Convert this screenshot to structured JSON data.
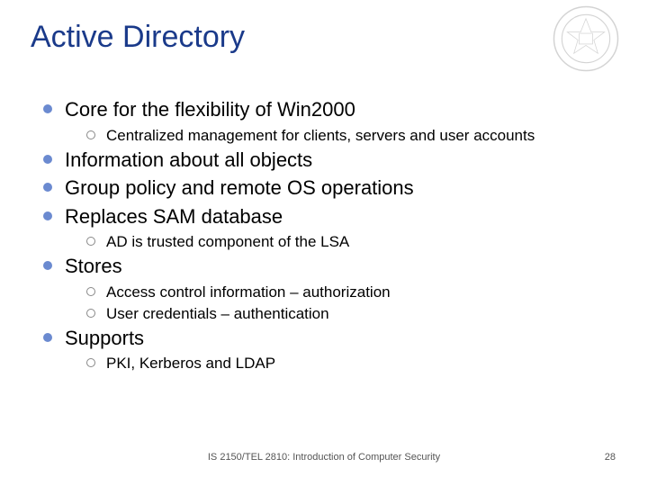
{
  "title": "Active Directory",
  "bullets": {
    "b0": {
      "text": "Core for the flexibility of Win2000"
    },
    "b0_sub0": {
      "text": "Centralized management for clients, servers and user accounts"
    },
    "b1": {
      "text": "Information about all objects"
    },
    "b2": {
      "text": "Group policy and remote OS operations"
    },
    "b3": {
      "text": "Replaces SAM database"
    },
    "b3_sub0": {
      "text": "AD is trusted component of the LSA"
    },
    "b4": {
      "text": "Stores"
    },
    "b4_sub0": {
      "text": "Access control information – authorization"
    },
    "b4_sub1": {
      "text": "User credentials – authentication"
    },
    "b5": {
      "text": "Supports"
    },
    "b5_sub0": {
      "text": "PKI, Kerberos and LDAP"
    }
  },
  "footer": {
    "center": "IS 2150/TEL 2810: Introduction of Computer Security",
    "page": "28"
  }
}
